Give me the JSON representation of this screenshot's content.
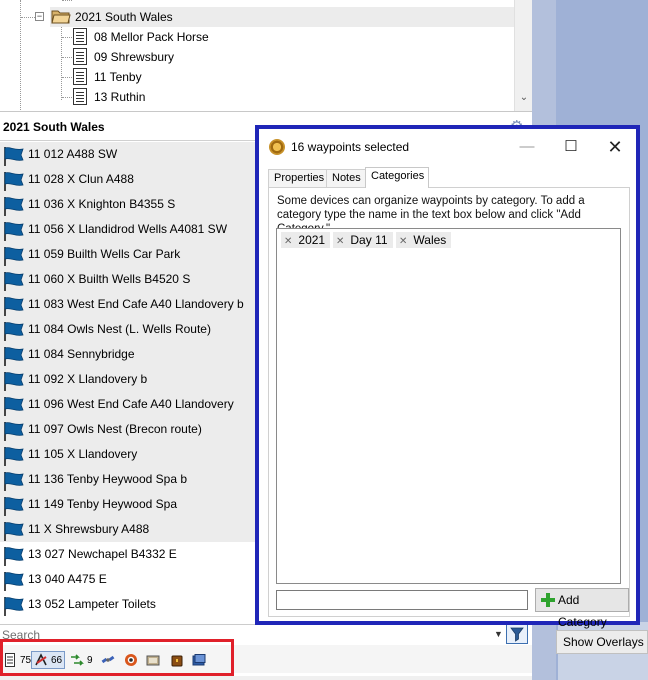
{
  "tree": {
    "folder_label": "2021 South Wales",
    "items": [
      {
        "label": "08 Mellor Pack Horse"
      },
      {
        "label": "09 Shrewsbury"
      },
      {
        "label": "11 Tenby"
      },
      {
        "label": "13 Ruthin"
      }
    ]
  },
  "list": {
    "title": "2021 South Wales",
    "waypoints": [
      {
        "label": "11 012 A488 SW",
        "selected": true
      },
      {
        "label": "11 028 X Clun A488",
        "selected": true
      },
      {
        "label": "11 036 X Knighton B4355 S",
        "selected": true
      },
      {
        "label": "11 056 X Llandidrod Wells A4081 SW",
        "selected": true
      },
      {
        "label": "11 059 Builth Wells Car Park",
        "selected": true
      },
      {
        "label": "11 060 X Builth Wells B4520 S",
        "selected": true
      },
      {
        "label": "11 083 West End Cafe A40 Llandovery b",
        "selected": true
      },
      {
        "label": "11 084 Owls Nest (L. Wells Route)",
        "selected": true
      },
      {
        "label": "11 084 Sennybridge",
        "selected": true
      },
      {
        "label": "11 092 X Llandovery b",
        "selected": true
      },
      {
        "label": "11 096 West End Cafe A40 Llandovery",
        "selected": true
      },
      {
        "label": "11 097 Owls Nest (Brecon route)",
        "selected": true
      },
      {
        "label": "11 105 X Llandovery",
        "selected": true
      },
      {
        "label": "11 136 Tenby Heywood Spa b",
        "selected": true
      },
      {
        "label": "11 149 Tenby Heywood Spa",
        "selected": true
      },
      {
        "label": "11 X Shrewsbury A488",
        "selected": true
      },
      {
        "label": "13 027 Newchapel B4332 E",
        "selected": false
      },
      {
        "label": "13 040 A475 E",
        "selected": false
      },
      {
        "label": "13 052 Lampeter Toilets",
        "selected": false
      }
    ]
  },
  "search": {
    "placeholder": "Search"
  },
  "toolbar": {
    "routes_count": "75",
    "waypoints_count": "66",
    "tracks_count": "9"
  },
  "right_panel": {
    "show_overlays_label": "Show Overlays"
  },
  "dialog": {
    "title": "16 waypoints selected",
    "tabs": [
      {
        "label": "Properties"
      },
      {
        "label": "Notes"
      },
      {
        "label": "Categories",
        "active": true
      }
    ],
    "help_text": "Some devices can organize waypoints by category.  To add a category type the name in the text box below and click \"Add Category.\"",
    "categories": [
      "2021",
      "Day 11",
      "Wales"
    ],
    "new_category_value": "",
    "add_button_label": "Add Category"
  },
  "colors": {
    "dialog_border": "#1f26b8",
    "toolbar_highlight": "#e0202a",
    "flag_blue": "#0d5fa0",
    "selection_gray": "#ececec",
    "panel_blue": "#9fb1d6"
  }
}
